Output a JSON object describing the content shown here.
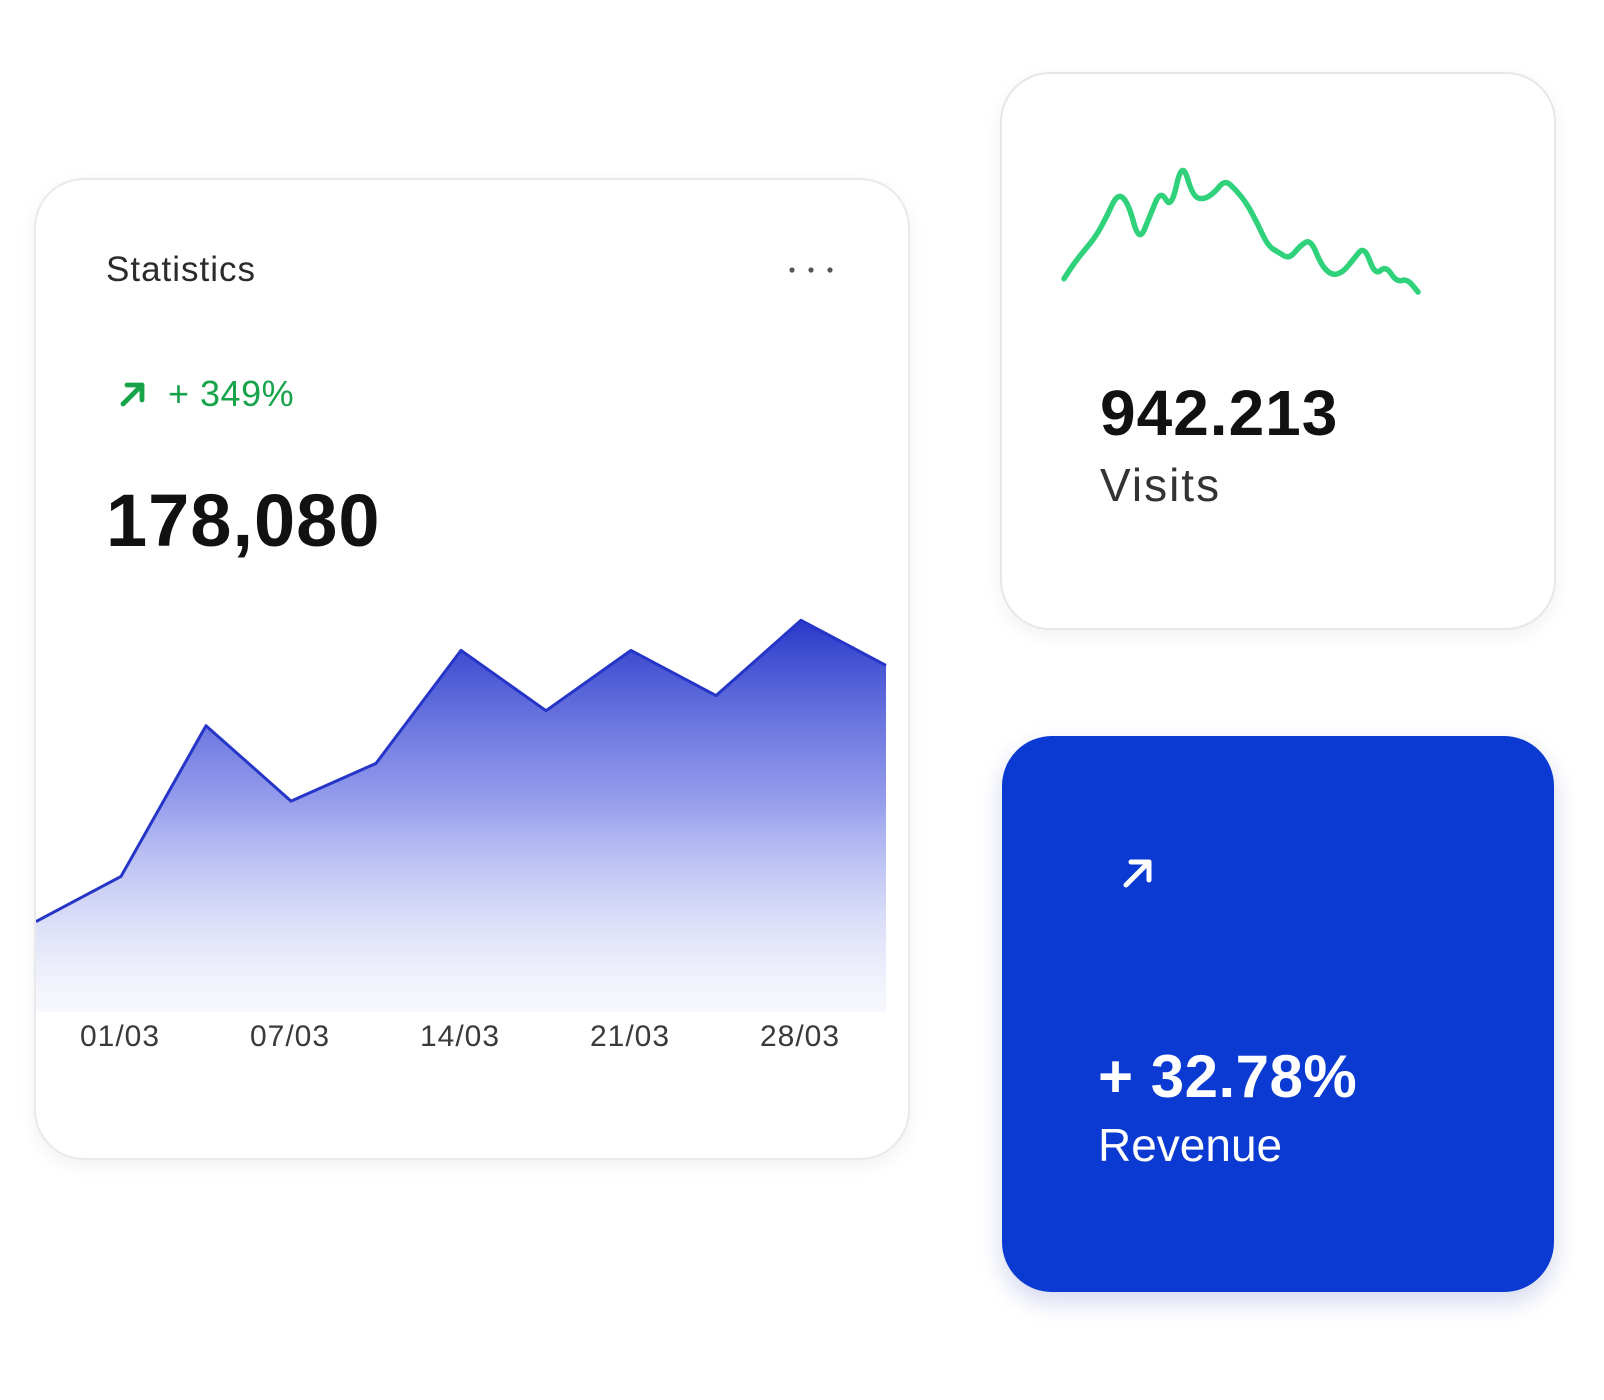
{
  "statistics_card": {
    "title": "Statistics",
    "more_icon": "more-horizontal-icon",
    "trend_icon": "arrow-up-right-icon",
    "trend_text": "+ 349%",
    "value": "178,080",
    "colors": {
      "accent": "#2535c8",
      "trend": "#16a34a"
    }
  },
  "chart_data": {
    "type": "area",
    "title": "",
    "xlabel": "",
    "ylabel": "",
    "x_tick_labels": [
      "01/03",
      "07/03",
      "14/03",
      "21/03",
      "28/03"
    ],
    "values": [
      12,
      18,
      38,
      28,
      33,
      48,
      40,
      48,
      42,
      52,
      46
    ],
    "ylim": [
      0,
      60
    ],
    "grid": false,
    "legend": "none"
  },
  "visits_card": {
    "sparkline_values": [
      10,
      20,
      28,
      36,
      48,
      62,
      56,
      32,
      48,
      64,
      52,
      82,
      60,
      58,
      62,
      70,
      64,
      56,
      44,
      30,
      26,
      22,
      30,
      34,
      18,
      12,
      14,
      22,
      30,
      12,
      18,
      8,
      10,
      2
    ],
    "value": "942.213",
    "label": "Visits",
    "color": "#2fd27a"
  },
  "revenue_card": {
    "arrow_icon": "arrow-up-right-icon",
    "value": "+ 32.78%",
    "label": "Revenue",
    "background": "#0a3ad2"
  }
}
